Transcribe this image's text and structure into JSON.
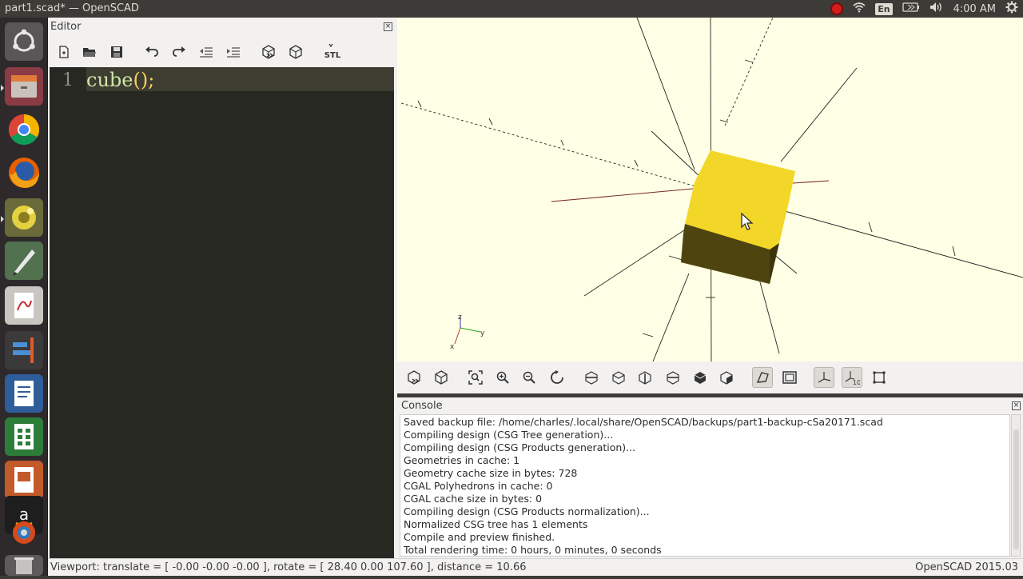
{
  "window": {
    "title": "part1.scad* — OpenSCAD"
  },
  "tray": {
    "lang": "En",
    "clock": "4:00 AM",
    "record_color": "#d31c1c"
  },
  "launcher": {
    "items": [
      "ubuntu-dash-icon",
      "files-icon",
      "chrome-icon",
      "firefox-icon",
      "openscad-icon",
      "inkscape-icon",
      "document-viewer-icon",
      "app-icon",
      "writer-icon",
      "calc-icon",
      "impress-icon",
      "amazon-icon",
      "app-store-icon",
      "trash-icon"
    ]
  },
  "editor": {
    "title": "Editor",
    "close_glyph": "×",
    "toolbar": [
      "new-file-icon",
      "open-file-icon",
      "save-icon",
      "undo-icon",
      "redo-icon",
      "unindent-icon",
      "indent-icon",
      "preview-icon",
      "render-icon",
      "export-stl-icon"
    ],
    "stl_label": "STL",
    "line_number": "1",
    "code_fn": "cube",
    "code_paren": "();"
  },
  "view_toolbar": [
    "preview-icon",
    "render-icon",
    "view-all-icon",
    "zoom-in-icon",
    "zoom-out-icon",
    "reset-view-icon",
    "view-right-icon",
    "view-top-icon",
    "view-bottom-icon",
    "view-left-icon",
    "view-front-icon",
    "view-back-icon",
    "perspective-icon",
    "orthogonal-icon",
    "show-axes-icon",
    "show-scale-markers-icon",
    "show-edges-icon"
  ],
  "scale_marker_label": "10",
  "console": {
    "title": "Console",
    "lines": [
      "Saved backup file: /home/charles/.local/share/OpenSCAD/backups/part1-backup-cSa20171.scad",
      "Compiling design (CSG Tree generation)...",
      "Compiling design (CSG Products generation)...",
      "Geometries in cache: 1",
      "Geometry cache size in bytes: 728",
      "CGAL Polyhedrons in cache: 0",
      "CGAL cache size in bytes: 0",
      "Compiling design (CSG Products normalization)...",
      "Normalized CSG tree has 1 elements",
      "Compile and preview finished.",
      "Total rendering time: 0 hours, 0 minutes, 0 seconds"
    ]
  },
  "status": {
    "viewport": "Viewport: translate = [ -0.00 -0.00 -0.00 ], rotate = [ 28.40 0.00 107.60 ], distance = 10.66",
    "version": "OpenSCAD 2015.03"
  },
  "colors": {
    "viewport_bg": "#ffffe5",
    "cube_top": "#f2d728",
    "cube_front": "#4d4410",
    "editor_bg": "#272822",
    "axis_x": "#7a2a2a"
  },
  "axis_labels": {
    "x": "x",
    "y": "y",
    "z": "z"
  }
}
